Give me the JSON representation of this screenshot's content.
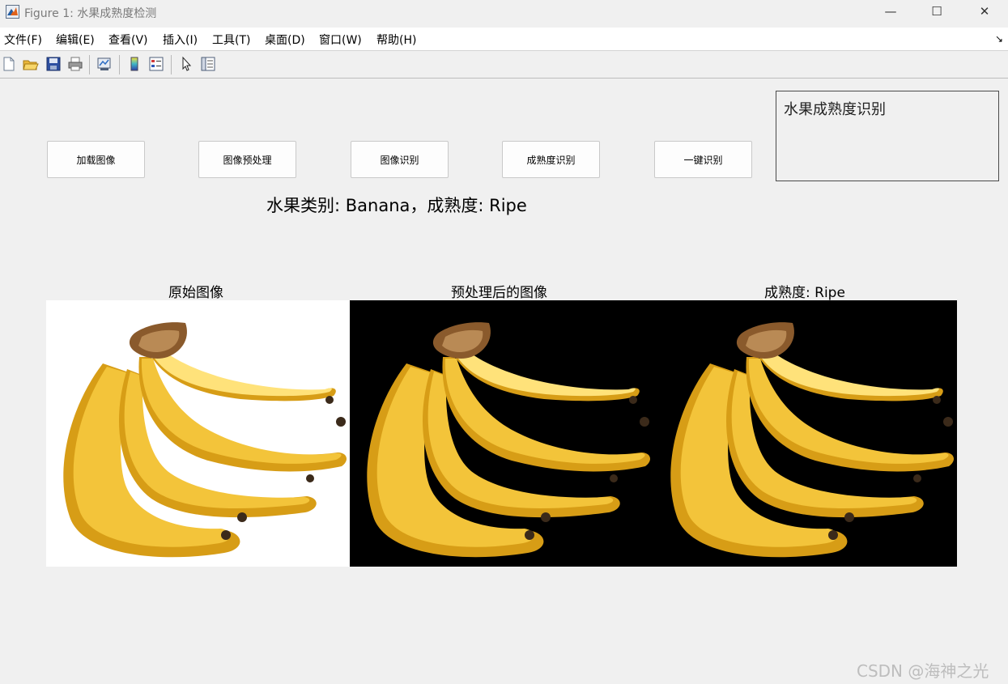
{
  "window": {
    "title": "Figure 1: 水果成熟度检测",
    "controls": {
      "minimize": "—",
      "maximize": "☐",
      "close": "✕"
    }
  },
  "menu": {
    "items": [
      "文件(F)",
      "编辑(E)",
      "查看(V)",
      "插入(I)",
      "工具(T)",
      "桌面(D)",
      "窗口(W)",
      "帮助(H)"
    ],
    "dock_icon": "↘"
  },
  "toolbar": {
    "icons": [
      "new-figure-icon",
      "open-file-icon",
      "save-icon",
      "print-icon",
      "link-plot-icon",
      "colorbar-icon",
      "legend-icon",
      "pointer-icon",
      "property-inspector-icon"
    ]
  },
  "buttons": {
    "load": "加载图像",
    "preprocess": "图像预处理",
    "recognize": "图像识别",
    "ripeness": "成熟度识别",
    "one_click": "一键识别"
  },
  "info_box": {
    "text": "水果成熟度识别"
  },
  "result": {
    "text": "水果类别: Banana，成熟度: Ripe"
  },
  "axes": {
    "original_title": "原始图像",
    "preprocessed_title": "预处理后的图像",
    "ripeness_title": "成熟度: Ripe"
  },
  "colors": {
    "banana_yellow": "#f3c43a",
    "banana_shadow": "#d79d16",
    "banana_highlight": "#ffe27a",
    "stem": "#8a5a2c"
  },
  "watermark": "CSDN @海神之光"
}
